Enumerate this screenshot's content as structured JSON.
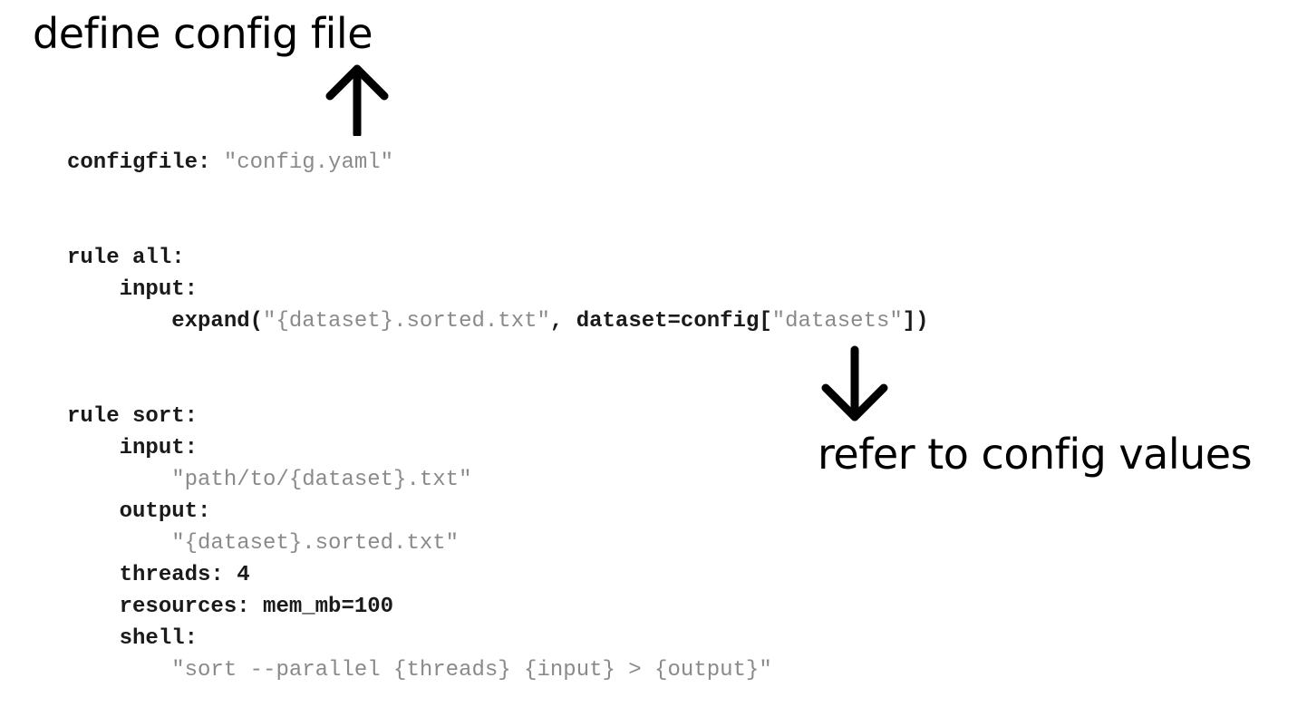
{
  "annotations": {
    "top_label": "define config file",
    "right_label": "refer to config values"
  },
  "code": {
    "line_01_key": "configfile: ",
    "line_01_str": "\"config.yaml\"",
    "line_04": "rule all:",
    "line_05": "    input:",
    "line_06_a": "        expand(",
    "line_06_str1": "\"{dataset}.sorted.txt\"",
    "line_06_b": ", dataset=config[",
    "line_06_str2": "\"datasets\"",
    "line_06_c": "])",
    "line_09": "rule sort:",
    "line_10": "    input:",
    "line_11_indent": "        ",
    "line_11_str": "\"path/to/{dataset}.txt\"",
    "line_12": "    output:",
    "line_13_indent": "        ",
    "line_13_str": "\"{dataset}.sorted.txt\"",
    "line_14": "    threads: 4",
    "line_15": "    resources: mem_mb=100",
    "line_16": "    shell:",
    "line_17_indent": "        ",
    "line_17_str": "\"sort --parallel {threads} {input} > {output}\""
  },
  "icons": {
    "arrow_up": "arrow-up-icon",
    "arrow_down": "arrow-down-icon"
  },
  "colors": {
    "text": "#000000",
    "code_keyword": "#1a1a1a",
    "code_string": "#8a8a8a",
    "background": "#ffffff"
  }
}
